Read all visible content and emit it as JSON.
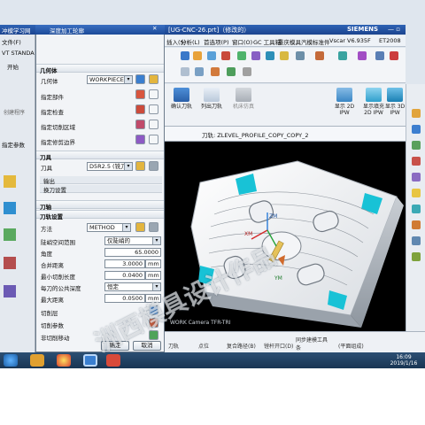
{
  "main_window": {
    "title": "[UG-CNC-26.prt]（修改的）",
    "brand": "SIEMENS",
    "menu": [
      "插入(S)",
      "分析(L)",
      "首选项(P)",
      "窗口(O)",
      "GC 工具箱",
      "重庆模具汽模标准件",
      "Vscar",
      "V6.935F",
      "ET2008"
    ],
    "toolbar_buttons": [
      {
        "label": "确认刀轨",
        "icon": "verify-toolpath-icon"
      },
      {
        "label": "列出刀轨",
        "icon": "list-toolpath-icon"
      },
      {
        "label": "机床仿真",
        "icon": "machine-sim-icon"
      },
      {
        "label": "显示 2D IPW",
        "icon": "ipw-2d-icon"
      },
      {
        "label": "显示填充 2D IPW",
        "icon": "ipw-fill-icon"
      },
      {
        "label": "显示 3D IPW",
        "icon": "ipw-3d-icon"
      }
    ],
    "view_title": "刀轨: ZLEVEL_PROFILE_COPY_COPY_2",
    "view_label": "WORK Camera TFR-TRI",
    "axis_labels": {
      "zm": "ZM",
      "xm": "XM",
      "ym": "YM"
    },
    "bottom_tools": [
      {
        "label": "刀轨"
      },
      {
        "label": "点位"
      },
      {
        "label": "复合路径(B)"
      },
      {
        "label": "镗杆开口(D)"
      },
      {
        "label": "同步建模工具条"
      },
      {
        "label": "(平面组成)"
      }
    ]
  },
  "left_app": {
    "title": "冲模学习网",
    "items": [
      "文件(F)",
      "VT STANDA",
      "开始",
      "创建程序",
      "指定参数"
    ]
  },
  "dialog": {
    "title": "深度加工轮廓",
    "geometry_section": "几何体",
    "geometry_label": "几何体",
    "geometry_value": "WORKPIECE",
    "geometry_rows": [
      "指定部件",
      "指定检查",
      "指定切削区域",
      "指定修剪边界"
    ],
    "tool_section": "刀具",
    "tool_label": "刀具",
    "tool_value": "D5R2.5 (铣刀-",
    "tool_sub1": "输出",
    "tool_sub2": "换刀设置",
    "axis_section": "刀轴",
    "tool_settings_section": "刀轨设置",
    "method_label": "方法",
    "method_value": "METHOD",
    "steep_label": "陡峭空间范围",
    "steep_value": "仅陡峭的",
    "angle_label": "角度",
    "angle_value": "65.0000",
    "merge_label": "合并距离",
    "merge_value": "3.0000",
    "merge_unit": "mm",
    "min_len_label": "最小切削长度",
    "min_len_value": "0.0400",
    "min_len_unit": "mm",
    "depth_label": "每刀的公共深度",
    "depth_value": "恒定",
    "max_dist_label": "最大距离",
    "max_dist_value": "0.0500",
    "max_dist_unit": "mm",
    "cut_layers": "切削层",
    "cut_params": "切削参数",
    "non_cut": "非切削移动",
    "ok": "确定",
    "cancel": "取消"
  },
  "watermark": "洲西模具设计作品",
  "taskbar": {
    "time": "16:09",
    "date": "2019/1/16"
  }
}
